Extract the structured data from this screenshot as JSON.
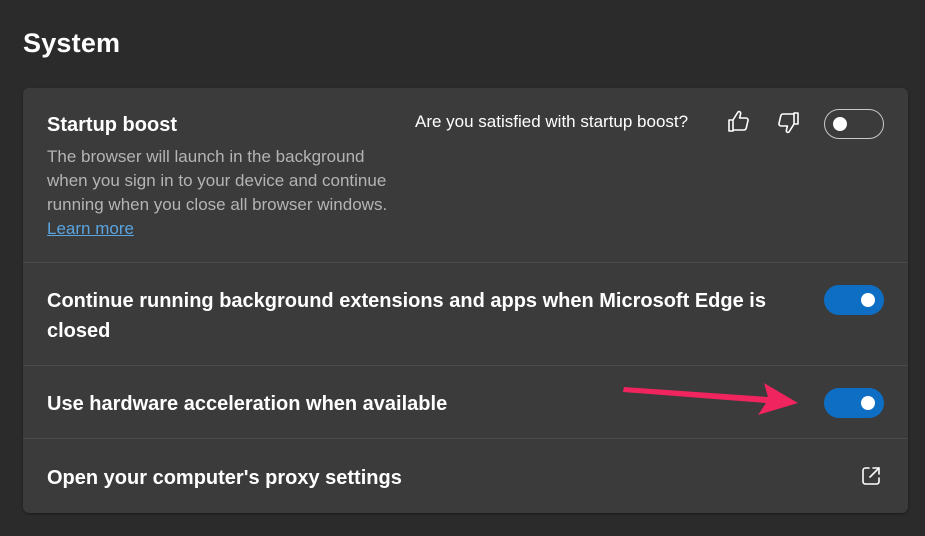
{
  "page": {
    "title": "System"
  },
  "settings": {
    "startup_boost": {
      "title": "Startup boost",
      "description": "The browser will launch in the background when you sign in to your device and continue running when you close all browser windows.",
      "learn_more": "Learn more",
      "feedback_question": "Are you satisfied with startup boost?",
      "enabled": false
    },
    "background_extensions": {
      "title": "Continue running background extensions and apps when Microsoft Edge is closed",
      "enabled": true
    },
    "hardware_acceleration": {
      "title": "Use hardware acceleration when available",
      "enabled": true
    },
    "proxy": {
      "title": "Open your computer's proxy settings"
    }
  },
  "icons": {
    "thumbs_up": "thumbs-up-icon",
    "thumbs_down": "thumbs-down-icon",
    "external_link": "external-link-icon"
  },
  "colors": {
    "background": "#2b2b2b",
    "card": "#3b3b3b",
    "toggle_on": "#0d6ec4",
    "link": "#5aa4e0",
    "annotation_arrow": "#f0245e"
  }
}
